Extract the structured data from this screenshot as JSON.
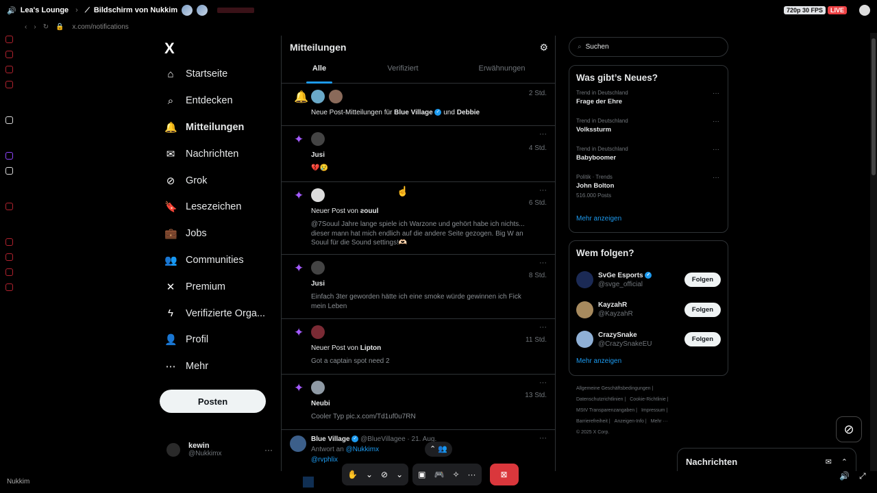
{
  "stream": {
    "channel": "Lea's Lounge",
    "title": "Bildschirm von Nukkim",
    "quality": "720p 30 FPS",
    "live": "LIVE",
    "user": "Nukkim",
    "url": "x.com/notifications"
  },
  "sidebar": {
    "logo": "X",
    "items": [
      {
        "label": "Startseite",
        "icon": "home-icon",
        "glyph": "⌂"
      },
      {
        "label": "Entdecken",
        "icon": "search-icon",
        "glyph": "⌕"
      },
      {
        "label": "Mitteilungen",
        "icon": "bell-icon",
        "glyph": "🔔"
      },
      {
        "label": "Nachrichten",
        "icon": "mail-icon",
        "glyph": "✉"
      },
      {
        "label": "Grok",
        "icon": "grok-icon",
        "glyph": "⊘"
      },
      {
        "label": "Lesezeichen",
        "icon": "bookmark-icon",
        "glyph": "🔖"
      },
      {
        "label": "Jobs",
        "icon": "briefcase-icon",
        "glyph": "💼"
      },
      {
        "label": "Communities",
        "icon": "people-icon",
        "glyph": "👥"
      },
      {
        "label": "Premium",
        "icon": "x-premium-icon",
        "glyph": "✕"
      },
      {
        "label": "Verifizierte Orga...",
        "icon": "lightning-icon",
        "glyph": "ϟ"
      },
      {
        "label": "Profil",
        "icon": "person-icon",
        "glyph": "👤"
      },
      {
        "label": "Mehr",
        "icon": "more-circle-icon",
        "glyph": "⋯"
      }
    ],
    "post_button": "Posten",
    "account": {
      "name": "kewin",
      "handle": "@Nukkimx",
      "dots": "···"
    }
  },
  "main": {
    "title": "Mitteilungen",
    "tabs": [
      {
        "label": "Alle"
      },
      {
        "label": "Verifiziert"
      },
      {
        "label": "Erwähnungen"
      }
    ],
    "notifications": [
      {
        "time": "2 Std.",
        "prefix": "Neue Post-Mitteilungen für ",
        "strong1": "Blue Village",
        "mid": " und ",
        "strong2": "Debbie"
      },
      {
        "time": "4 Std.",
        "name": "Jusi",
        "body": "💔😢"
      },
      {
        "time": "6 Std.",
        "prefix": "Neuer Post von ",
        "strong1": "ƨouul",
        "body": "@7Souul Jahre lange spiele ich Warzone und gehört habe ich nichts... dieser mann hat mich endlich auf die andere Seite gezogen. Big W an Souul für die Sound settings!🫶🏻"
      },
      {
        "time": "8 Std.",
        "name": "Jusi",
        "body": "Einfach 3ter geworden hätte ich eine smoke würde gewinnen ich Fick mein Leben"
      },
      {
        "time": "11 Std.",
        "prefix": "Neuer Post von ",
        "strong1": "Lipton",
        "body": "Got a captain spot need 2"
      },
      {
        "time": "13 Std.",
        "name": "Neubi",
        "body": "Cooler Typ pic.x.com/Td1uf0u7RN"
      }
    ],
    "reply": {
      "name": "Blue Village",
      "handle": "@BlueVillagee · 21. Aug.",
      "reply_to": "Antwort an ",
      "mention": "@Nukkimx",
      "tag": "@rvphlix"
    }
  },
  "right": {
    "search_placeholder": "Suchen",
    "trends_title": "Was gibt’s Neues?",
    "trends": [
      {
        "context": "Trend in Deutschland",
        "title": "Frage der Ehre",
        "count": ""
      },
      {
        "context": "Trend in Deutschland",
        "title": "Volkssturm",
        "count": ""
      },
      {
        "context": "Trend in Deutschland",
        "title": "Babyboomer",
        "count": ""
      },
      {
        "context": "Politik · Trends",
        "title": "John Bolton",
        "count": "516.000 Posts"
      }
    ],
    "show_more": "Mehr anzeigen",
    "follow_title": "Wem folgen?",
    "follow": [
      {
        "name": "SvGe Esports",
        "handle": "@svge_official",
        "verified": true,
        "button": "Folgen"
      },
      {
        "name": "KayzahR",
        "handle": "@KayzahR",
        "verified": false,
        "button": "Folgen"
      },
      {
        "name": "CrazySnake",
        "handle": "@CrazySnakeEU",
        "verified": false,
        "button": "Folgen"
      }
    ],
    "footer": [
      "Allgemeine Geschäftsbedingungen |",
      "Datenschutzrichtlinien |",
      "Cookie-Richtlinie |",
      "MStV Transparenzangaben |",
      "Impressum |",
      "Barrierefreiheit |",
      "Anzeigen-Info |",
      "Mehr ···",
      "© 2025 X Corp."
    ],
    "messages": "Nachrichten"
  },
  "colors": {
    "accent": "#1d9bf0",
    "sparkle": "#a45bff",
    "end_call": "#da373c"
  }
}
